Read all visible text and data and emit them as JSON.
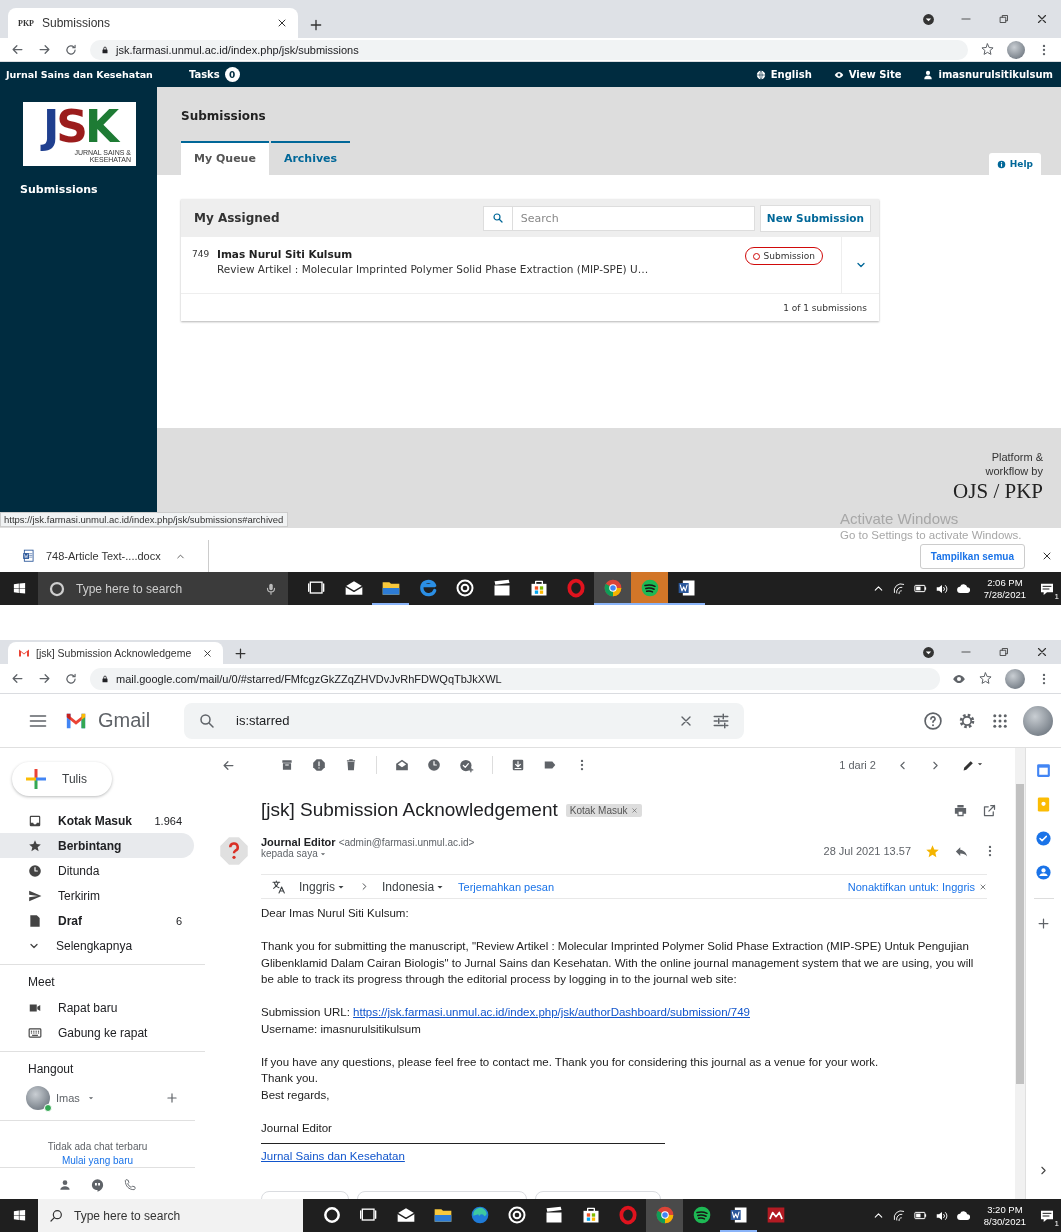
{
  "ojs_window": {
    "tab": {
      "favicon_text": "PKP",
      "title": "Submissions"
    },
    "url": "jsk.farmasi.unmul.ac.id/index.php/jsk/submissions",
    "header": {
      "site_name": "Jurnal Sains dan Kesehatan",
      "tasks_label": "Tasks",
      "tasks_count": "0",
      "links": [
        {
          "kind": "globe",
          "label": "English"
        },
        {
          "kind": "eye",
          "label": "View Site"
        },
        {
          "kind": "user",
          "label": "imasnurulsitikulsum"
        }
      ]
    },
    "logo": {
      "letters": "JSK",
      "caption": "JURNAL SAINS & KESEHATAN"
    },
    "sidebar_items": [
      "Submissions"
    ],
    "page_title": "Submissions",
    "tabs": [
      {
        "label": "My Queue",
        "selected": true
      },
      {
        "label": "Archives",
        "selected": false
      }
    ],
    "help": "Help",
    "panel": {
      "title": "My Assigned",
      "search_placeholder": "Search",
      "new_button": "New Submission",
      "rows": [
        {
          "id": "749",
          "author": "Imas Nurul Siti Kulsum",
          "title": "Review Artikel : Molecular Imprinted Polymer Solid Phase Extraction (MIP-SPE) U…",
          "stage": "Submission"
        }
      ],
      "count": "1 of 1 submissions"
    },
    "footer": {
      "lines": [
        "Platform &",
        "workflow by"
      ],
      "brand": "OJS / PKP"
    },
    "status_url": "https://jsk.farmasi.unmul.ac.id/index.php/jsk/submissions#archived",
    "download": {
      "file": "748-Article Text-....docx",
      "show_all": "Tampilkan semua"
    },
    "activate": {
      "title": "Activate Windows",
      "subtitle": "Go to Settings to activate Windows."
    },
    "taskbar": {
      "search_box": {
        "kind": "dark",
        "placeholder": "Type here to search"
      },
      "time": "2:06 PM",
      "date": "7/28/2021",
      "notifications": "1",
      "apps": [
        {
          "kind": "taskview",
          "open": false,
          "selected": false,
          "flashing": false
        },
        {
          "kind": "mail",
          "open": false,
          "selected": false,
          "flashing": false
        },
        {
          "kind": "folder",
          "open": true,
          "selected": false,
          "flashing": false
        },
        {
          "kind": "edge",
          "open": false,
          "selected": false,
          "flashing": false
        },
        {
          "kind": "groove",
          "open": false,
          "selected": false,
          "flashing": false
        },
        {
          "kind": "film",
          "open": false,
          "selected": false,
          "flashing": false
        },
        {
          "kind": "store",
          "open": false,
          "selected": false,
          "flashing": false
        },
        {
          "kind": "opera",
          "open": false,
          "selected": false,
          "flashing": false
        },
        {
          "kind": "chrome",
          "open": true,
          "selected": true,
          "flashing": false
        },
        {
          "kind": "spotify",
          "open": true,
          "selected": false,
          "flashing": true
        },
        {
          "kind": "word",
          "open": true,
          "selected": false,
          "flashing": false
        }
      ]
    }
  },
  "gmail_window": {
    "tab": {
      "title": "[jsk] Submission Acknowledgeme"
    },
    "url": "mail.google.com/mail/u/0/#starred/FMfcgzGkZZqZHVDvJvRhFDWQqTbJkXWL",
    "app_name": "Gmail",
    "search_value": "is:starred",
    "compose": "Tulis",
    "nav": [
      {
        "kind": "inbox",
        "label": "Kotak Masuk",
        "count": "1.964",
        "unread": true,
        "selected": false
      },
      {
        "kind": "star",
        "label": "Berbintang",
        "unread": true,
        "selected": true
      },
      {
        "kind": "clock",
        "label": "Ditunda",
        "unread": false,
        "selected": false
      },
      {
        "kind": "send",
        "label": "Terkirim",
        "unread": false,
        "selected": false
      },
      {
        "kind": "draft",
        "label": "Draf",
        "count": "6",
        "unread": true,
        "selected": false
      },
      {
        "kind": "more",
        "label": "Selengkapnya",
        "unread": false,
        "selected": false
      }
    ],
    "meet": {
      "title": "Meet",
      "items": [
        {
          "kind": "video",
          "label": "Rapat baru"
        },
        {
          "kind": "keyboard",
          "label": "Gabung ke rapat"
        }
      ]
    },
    "hangout": {
      "title": "Hangout",
      "user": "Imas",
      "empty": "Tidak ada chat terbaru",
      "start_link": "Mulai yang baru"
    },
    "pager": "1 dari 2",
    "subject": "[jsk] Submission Acknowledgement",
    "label": "Kotak Masuk",
    "sender": {
      "name": "Journal Editor",
      "email": "<admin@farmasi.unmul.ac.id>",
      "to": "kepada saya",
      "date": "28 Jul 2021 13.57",
      "starred": true
    },
    "translate": {
      "from": "Inggris",
      "to": "Indonesia",
      "action": "Terjemahkan pesan",
      "disable": "Nonaktifkan untuk: Inggris"
    },
    "body": {
      "greeting": "Dear Imas Nurul Siti Kulsum:",
      "intro": "Thank you for submitting the manuscript, \"Review Artikel : Molecular Imprinted Polymer Solid Phase Extraction (MIP-SPE) Untuk Pengujian Glibenklamid Dalam Cairan Biologis\" to Jurnal Sains dan Kesehatan. With the online journal management system that we are using, you will be able to track its progress through the editorial process by logging in to the journal web site:",
      "url_label": "Submission URL:",
      "url": "https://jsk.farmasi.unmul.ac.id/index.php/jsk/authorDashboard/submission/749",
      "username": "Username: imasnurulsitikulsum",
      "closing_lines": [
        "If you have any questions, please feel free to contact me. Thank you for considering this journal as a venue for your work.",
        "Thank you.",
        "Best regards,"
      ],
      "signature_name": "Journal Editor",
      "signature_link": "Jurnal Sains dan Kesehatan"
    },
    "taskbar": {
      "search_box": {
        "kind": "light",
        "placeholder": "Type here to search"
      },
      "time": "3:20 PM",
      "date": "8/30/2021",
      "notifications": "1",
      "apps": [
        {
          "kind": "cortana",
          "open": false,
          "selected": false,
          "flashing": false
        },
        {
          "kind": "taskview",
          "open": false,
          "selected": false,
          "flashing": false
        },
        {
          "kind": "mail",
          "open": false,
          "selected": false,
          "flashing": false
        },
        {
          "kind": "folder",
          "open": false,
          "selected": false,
          "flashing": false
        },
        {
          "kind": "edge_new",
          "open": false,
          "selected": false,
          "flashing": false
        },
        {
          "kind": "groove",
          "open": false,
          "selected": false,
          "flashing": false
        },
        {
          "kind": "film",
          "open": false,
          "selected": false,
          "flashing": false
        },
        {
          "kind": "store",
          "open": false,
          "selected": false,
          "flashing": false
        },
        {
          "kind": "opera",
          "open": false,
          "selected": false,
          "flashing": false
        },
        {
          "kind": "chrome",
          "open": false,
          "selected": true,
          "flashing": false
        },
        {
          "kind": "spotify",
          "open": false,
          "selected": false,
          "flashing": false
        },
        {
          "kind": "word",
          "open": true,
          "selected": false,
          "flashing": false
        },
        {
          "kind": "mendeley",
          "open": false,
          "selected": false,
          "flashing": false
        }
      ]
    }
  }
}
